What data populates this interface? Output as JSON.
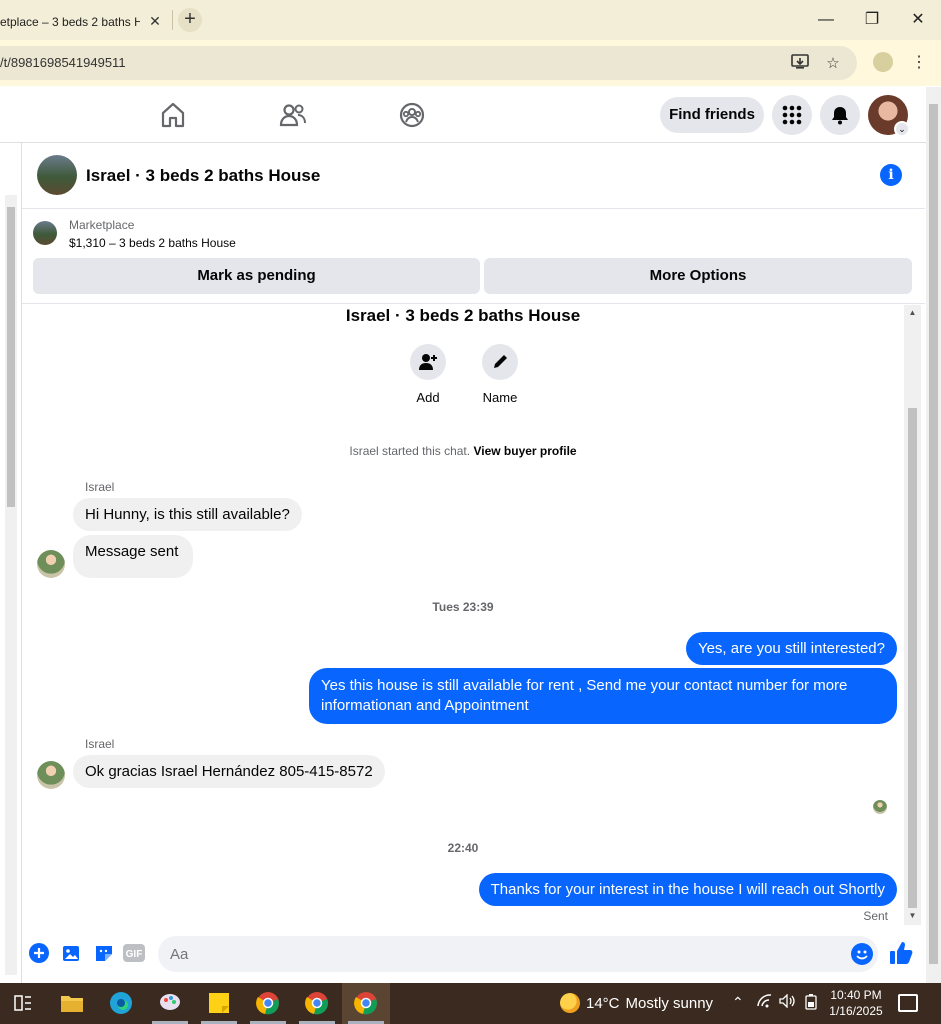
{
  "browser": {
    "tab_title": "etplace – 3 beds 2 baths H",
    "tab_close": "✕",
    "new_tab": "+",
    "url": "/t/8981698541949511",
    "win_min": "—",
    "win_restore": "❐",
    "win_close": "✕"
  },
  "nav": {
    "find_friends": "Find friends"
  },
  "conversation": {
    "title": "Israel · 3 beds 2 baths House",
    "info_icon": "i"
  },
  "marketplace": {
    "label": "Marketplace",
    "listing": "$1,310 – 3 beds 2 baths House",
    "mark_pending": "Mark as pending",
    "more_options": "More Options"
  },
  "chat": {
    "title": "Israel · 3 beds 2 baths House",
    "actions": [
      {
        "label": "Add",
        "icon": "add-person-icon"
      },
      {
        "label": "Name",
        "icon": "pencil-icon"
      }
    ],
    "system_text": "Israel started this chat.",
    "system_link": "View buyer profile",
    "messages": [
      {
        "sender": "Israel",
        "text": "Hi Hunny, is this still available?"
      },
      {
        "text": "Message sent"
      },
      {
        "timestamp": "Tues 23:39"
      },
      {
        "out": "Yes, are you still interested?"
      },
      {
        "out": "Yes this house is still available for rent , Send me your contact number for more informationan and Appointment"
      },
      {
        "sender": "Israel",
        "text": "Ok gracias Israel Hernández 805-415-8572"
      },
      {
        "timestamp": "22:40"
      },
      {
        "out": "Thanks for your interest in the house I will reach out Shortly"
      }
    ],
    "sent_label": "Sent"
  },
  "composer": {
    "placeholder": "Aa",
    "gif_label": "GIF"
  },
  "taskbar": {
    "temperature": "14°C",
    "weather": "Mostly sunny",
    "time": "10:40 PM",
    "date": "1/16/2025"
  },
  "colors": {
    "accent": "#0866ff",
    "bubble_in": "#f0f0f0",
    "tabstrip": "#f3eed7",
    "taskbar": "#3a2a1f"
  }
}
